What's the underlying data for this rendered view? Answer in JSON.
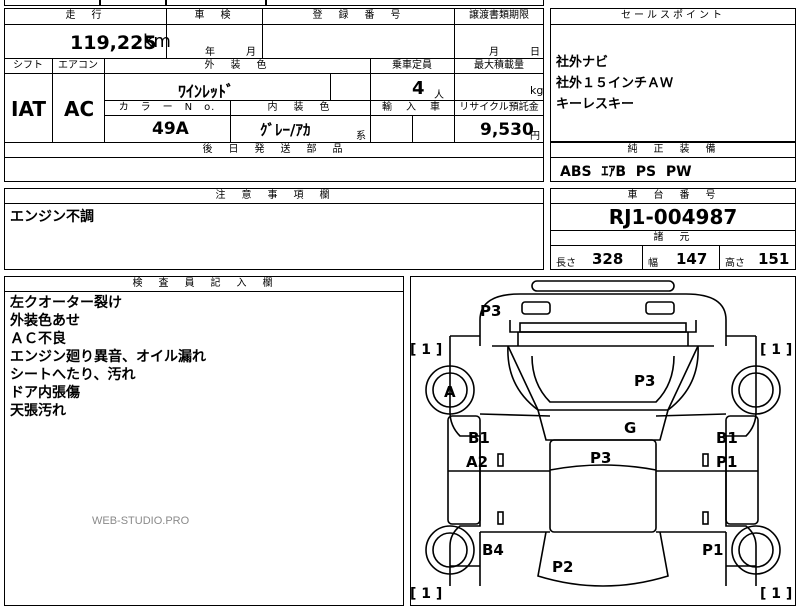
{
  "top_form": {
    "mileage_header": "走　行",
    "mileage_value": "119,225",
    "mileage_unit": "km",
    "inspection_header": "車　検",
    "inspection_year": "年",
    "inspection_month": "月",
    "registration_header": "登　録　番　号",
    "transfer_header": "譲渡書類期限",
    "transfer_month": "月",
    "transfer_day": "日",
    "shift_header": "シフト",
    "aircon_header": "エアコン",
    "exterior_header": "外　装　色",
    "capacity_header": "乗車定員",
    "load_header": "最大積載量",
    "shift_value": "IAT",
    "aircon_value": "AC",
    "exterior_value": "ﾜｲﾝﾚｯﾄﾞ",
    "capacity_value": "4",
    "capacity_unit": "人",
    "load_unit": "kg",
    "color_no_header": "カ　ラ　ー　N　o.",
    "interior_header": "内　装　色",
    "import_header": "輸　入　車",
    "recycle_header": "リサイクル預託金",
    "color_no_value": "49A",
    "interior_value": "ｸﾞﾚｰ/ｱｶ",
    "interior_suffix": "系",
    "recycle_value": "9,530",
    "recycle_unit": "円",
    "parts_header": "後　日　発　送　部　品"
  },
  "sales_points": {
    "header": "セールスポイント",
    "items": [
      "社外ナビ",
      "社外１５インチＡＷ",
      "キーレスキー"
    ]
  },
  "standard_equipment": {
    "header": "純　正　装　備",
    "value": "ABS  ｴｱB  PS  PW"
  },
  "caution": {
    "header": "注　意　事　項　欄",
    "text": "エンジン不調"
  },
  "chassis": {
    "header": "車　台　番　号",
    "value": "RJ1-004987"
  },
  "dimensions": {
    "header": "諸　元",
    "length_label": "長さ",
    "length_value": "328",
    "width_label": "幅",
    "width_value": "147",
    "height_label": "高さ",
    "height_value": "151"
  },
  "inspector": {
    "header": "検　査　員　記　入　欄",
    "notes": [
      "左クオーター裂け",
      "外装色あせ",
      "ＡＣ不良",
      "エンジン廻り異音、オイル漏れ",
      "シートへたり、汚れ",
      "ドア内張傷",
      "天張汚れ"
    ]
  },
  "watermark": "WEB-STUDIO.PRO",
  "diagram": {
    "marks": [
      "P3",
      "P3",
      "A",
      "G",
      "P3",
      "B1",
      "A2",
      "B1",
      "P1",
      "B4",
      "P1",
      "P2"
    ],
    "tire_labels": [
      "[ 1 ]",
      "[ 1 ]",
      "[ 1 ]",
      "[ 1 ]"
    ]
  }
}
